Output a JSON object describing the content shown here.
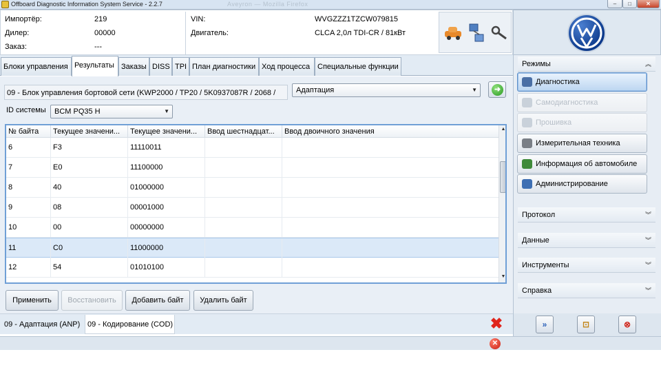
{
  "window": {
    "title": "Offboard Diagnostic Information System Service - 2.2.7",
    "background_title": "Aveyron — Mozilla Firefox",
    "controls": {
      "minimize": "–",
      "maximize": "□",
      "close": "✕"
    }
  },
  "info": {
    "importer_label": "Импортёр:",
    "importer_value": "219",
    "dealer_label": "Дилер:",
    "dealer_value": "00000",
    "order_label": "Заказ:",
    "order_value": "---",
    "vin_label": "VIN:",
    "vin_value": "WVGZZZ1TZCW079815",
    "engine_label": "Двигатель:",
    "engine_value": "CLCA 2,0л TDI-CR / 81кВт"
  },
  "tabs": [
    {
      "label": "Блоки управления"
    },
    {
      "label": "Результаты"
    },
    {
      "label": "Заказы"
    },
    {
      "label": "DISS"
    },
    {
      "label": "TPI"
    },
    {
      "label": "План диагностики"
    },
    {
      "label": "Ход процесса"
    },
    {
      "label": "Специальные функции"
    }
  ],
  "module": {
    "label": "09 - Блок управления бортовой сети  (KWP2000 / TP20 / 5K0937087R  / 2068 /",
    "mode_value": "Адаптация",
    "system_id_label": "ID системы",
    "system_id_value": "BCM PQ35 H"
  },
  "table": {
    "columns": [
      "№ байта",
      "Текущее значени...",
      "Текущее значени...",
      "Ввод шестнадцат...",
      "Ввод двоичного значения"
    ],
    "rows": [
      {
        "byte": "6",
        "hex": "F3",
        "bin": "11110011",
        "selected": false
      },
      {
        "byte": "7",
        "hex": "E0",
        "bin": "11100000",
        "selected": false
      },
      {
        "byte": "8",
        "hex": "40",
        "bin": "01000000",
        "selected": false
      },
      {
        "byte": "9",
        "hex": "08",
        "bin": "00001000",
        "selected": false
      },
      {
        "byte": "10",
        "hex": "00",
        "bin": "00000000",
        "selected": false
      },
      {
        "byte": "11",
        "hex": "C0",
        "bin": "11000000",
        "selected": true
      },
      {
        "byte": "12",
        "hex": "54",
        "bin": "01010100",
        "selected": false
      }
    ]
  },
  "buttons": {
    "apply": "Применить",
    "restore": "Восстановить",
    "add_byte": "Добавить байт",
    "delete_byte": "Удалить байт"
  },
  "subtabs": [
    {
      "label": "09 - Адаптация (ANP)"
    },
    {
      "label": "09 - Кодирование (COD)"
    }
  ],
  "sidebar": {
    "modes_title": "Режимы",
    "modes": [
      {
        "label": "Диагностика",
        "state": "active",
        "icon_color": "#4a6fa5"
      },
      {
        "label": "Самодиагностика",
        "state": "disabled",
        "icon_color": "#c9d1da"
      },
      {
        "label": "Прошивка",
        "state": "disabled",
        "icon_color": "#c9d1da"
      },
      {
        "label": "Измерительная техника",
        "state": "normal",
        "icon_color": "#7a7f86"
      },
      {
        "label": "Информация об автомобиле",
        "state": "normal",
        "icon_color": "#3f8a3a"
      },
      {
        "label": "Администрирование",
        "state": "normal",
        "icon_color": "#3e6fb3"
      }
    ],
    "sections": [
      {
        "label": "Протокол"
      },
      {
        "label": "Данные"
      },
      {
        "label": "Инструменты"
      },
      {
        "label": "Справка"
      }
    ]
  },
  "icons": {
    "go": "arrow-right-icon",
    "close_big": "red-x-icon",
    "status_error": "error-icon",
    "forward": "double-arrow-icon",
    "fit": "frame-icon",
    "exit": "exit-icon"
  },
  "colors": {
    "accent": "#6f9fd6",
    "selected_row": "#dbe9f8",
    "error_red": "#e0241b",
    "vw_blue": "#0d3a8c"
  }
}
